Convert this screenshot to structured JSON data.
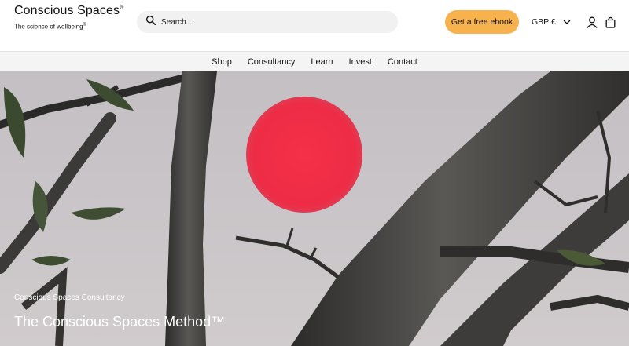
{
  "brand": {
    "name": "Conscious Spaces",
    "name_mark": "®",
    "tagline": "The science of wellbeing",
    "tagline_mark": "®"
  },
  "search": {
    "placeholder": "Search..."
  },
  "cta": {
    "label": "Get a free ebook",
    "color": "#f7b24e"
  },
  "currency": {
    "label": "GBP £"
  },
  "icons": {
    "search": "search-icon",
    "currency_toggle": "chevron-down-icon",
    "account": "user-icon",
    "cart": "shopping-bag-icon"
  },
  "nav": {
    "items": [
      {
        "label": "Shop"
      },
      {
        "label": "Consultancy"
      },
      {
        "label": "Learn"
      },
      {
        "label": "Invest"
      },
      {
        "label": "Contact"
      }
    ]
  },
  "hero": {
    "eyebrow": "Conscious Spaces Consultancy",
    "title": "The Conscious Spaces Method™",
    "sun_color": "#f02d45"
  }
}
